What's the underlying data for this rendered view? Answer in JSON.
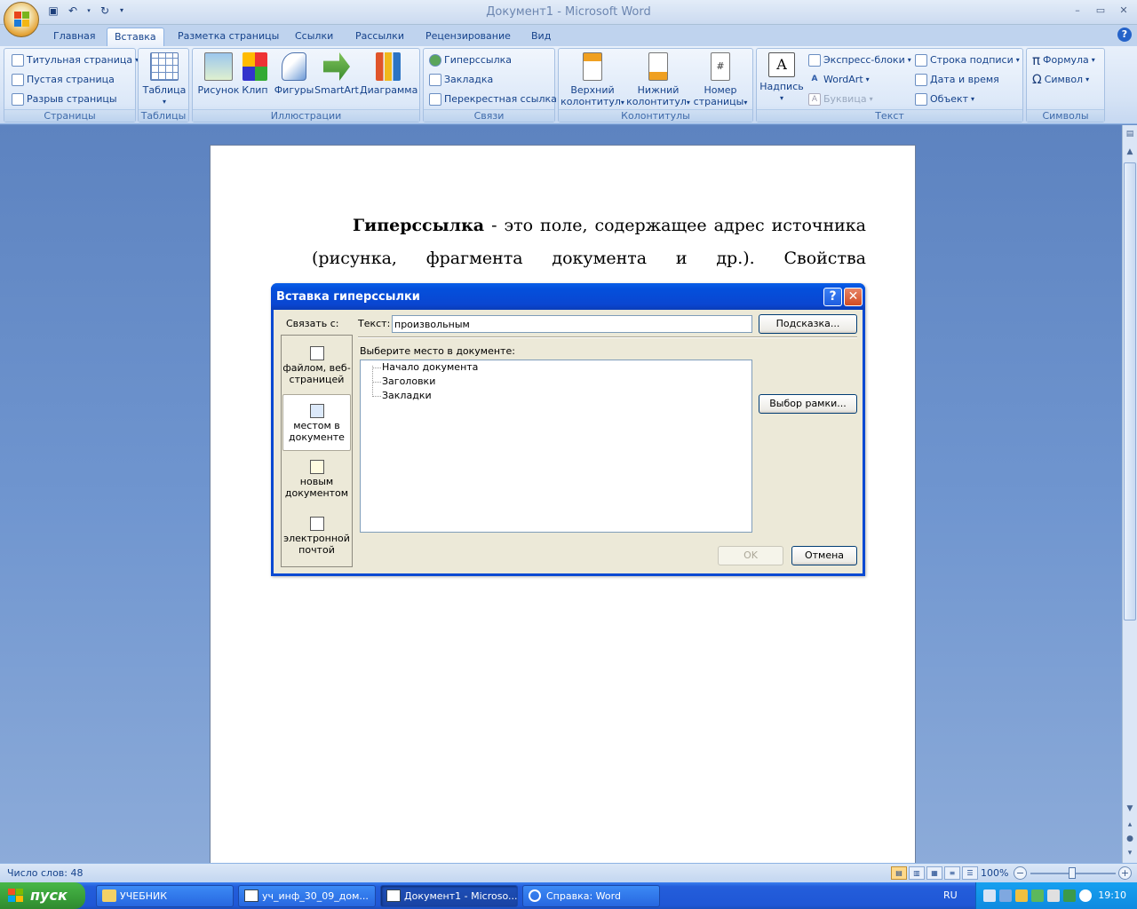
{
  "window": {
    "title": "Документ1 - Microsoft Word"
  },
  "tabs": [
    "Главная",
    "Вставка",
    "Разметка страницы",
    "Ссылки",
    "Рассылки",
    "Рецензирование",
    "Вид"
  ],
  "active_tab": "Вставка",
  "ribbon": {
    "pages": {
      "label": "Страницы",
      "items": [
        "Титульная страница",
        "Пустая страница",
        "Разрыв страницы"
      ]
    },
    "tables": {
      "label": "Таблицы",
      "table": "Таблица"
    },
    "illustrations": {
      "label": "Иллюстрации",
      "items": [
        "Рисунок",
        "Клип",
        "Фигуры",
        "SmartArt",
        "Диаграмма"
      ]
    },
    "links": {
      "label": "Связи",
      "items": [
        "Гиперссылка",
        "Закладка",
        "Перекрестная ссылка"
      ]
    },
    "headers": {
      "label": "Колонтитулы",
      "header": [
        "Верхний",
        "колонтитул"
      ],
      "footer": [
        "Нижний",
        "колонтитул"
      ],
      "pagenum": [
        "Номер",
        "страницы"
      ]
    },
    "text": {
      "label": "Текст",
      "textbox": "Надпись",
      "quickparts": "Экспресс-блоки",
      "wordart": "WordArt",
      "dropcap": "Буквица",
      "sigline": "Строка подписи",
      "datetime": "Дата и время",
      "object": "Объект"
    },
    "symbols": {
      "label": "Символы",
      "equation": "Формула",
      "symbol": "Символ"
    }
  },
  "document": {
    "bold_term": "Гиперссылка",
    "line1_rest": " - это поле, содержащее адрес источника",
    "line2": "(рисунка, фрагмента документа и др.). Свойства гиперссылки"
  },
  "dialog": {
    "title": "Вставка гиперссылки",
    "link_to_label": "Связать с:",
    "text_label": "Текст:",
    "text_value": "произвольным",
    "tooltip_button": "Подсказка...",
    "place_label": "Выберите место в документе:",
    "tree": [
      "Начало документа",
      "Заголовки",
      "Закладки"
    ],
    "frame_button": "Выбор рамки...",
    "ok": "OK",
    "cancel": "Отмена",
    "link_options": [
      {
        "l1": "файлом, веб-",
        "l2": "страницей"
      },
      {
        "l1": "местом в",
        "l2": "документе"
      },
      {
        "l1": "новым",
        "l2": "документом"
      },
      {
        "l1": "электронной",
        "l2": "почтой"
      }
    ]
  },
  "statusbar": {
    "words": "Число слов: 48",
    "zoom": "100%"
  },
  "taskbar": {
    "start": "пуск",
    "tasks": [
      "УЧЕБНИК",
      "уч_инф_30_09_дом...",
      "Документ1 - Microso...",
      "Справка: Word"
    ],
    "lang": "RU",
    "clock": "19:10"
  },
  "colors": {
    "accent": "#15428b",
    "xp_blue": "#0a49d2",
    "start_green": "#389d38"
  }
}
